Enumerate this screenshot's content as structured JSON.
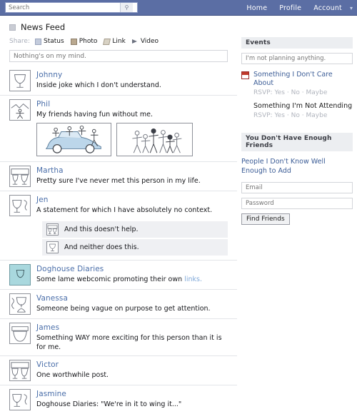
{
  "topbar": {
    "search_placeholder": "Search",
    "search_value": "",
    "search_icon": "search-icon",
    "nav": [
      {
        "label": "Home"
      },
      {
        "label": "Profile"
      },
      {
        "label": "Account"
      }
    ],
    "caret": "▾"
  },
  "page": {
    "title": "News Feed"
  },
  "share": {
    "label": "Share:",
    "items": [
      {
        "label": "Status",
        "icon": "status-icon"
      },
      {
        "label": "Photo",
        "icon": "photo-icon"
      },
      {
        "label": "Link",
        "icon": "link-icon"
      },
      {
        "label": "Video",
        "icon": "video-icon"
      }
    ],
    "status_placeholder": "Nothing's on my mind.",
    "status_value": ""
  },
  "feed": [
    {
      "name": "Johnny",
      "text": "Inside joke which I don't understand.",
      "avatar": "goblet"
    },
    {
      "name": "Phil",
      "text": "My friends having fun without me.",
      "avatar": "landscape",
      "photos": [
        {
          "caption": "car-party-photo"
        },
        {
          "caption": "crowd-photo"
        }
      ]
    },
    {
      "name": "Martha",
      "text": "Pretty sure I've never met this person in my life.",
      "avatar": "two-figures"
    },
    {
      "name": "Jen",
      "text": "A statement for which I have absolutely no context.",
      "avatar": "goblet-curve",
      "comments": [
        {
          "text": "And this doesn't help.",
          "avatar": "two-figures"
        },
        {
          "text": "And neither does this.",
          "avatar": "goblet"
        }
      ]
    },
    {
      "name": "Doghouse Diaries",
      "text_before": "Some lame webcomic promoting their own ",
      "link_text": "links.",
      "avatar": "goblet",
      "tinted": true
    },
    {
      "name": "Vanessa",
      "text": "Someone being vague on purpose to get attention.",
      "avatar": "hourglass"
    },
    {
      "name": "James",
      "text": "Something WAY more exciting for this person than it is for me.",
      "avatar": "bowl"
    },
    {
      "name": "Victor",
      "text": "One worthwhile post.",
      "avatar": "two-figures"
    },
    {
      "name": "Jasmine",
      "text": "Doghouse Diaries: \"We're in it to wing it...\"",
      "avatar": "goblet-curve"
    }
  ],
  "sidebar": {
    "events": {
      "header": "Events",
      "input_placeholder": "I'm not planning anything.",
      "input_value": "",
      "items": [
        {
          "title": "Something I Don't Care About",
          "is_link": true,
          "rsvp_label": "RSVP:",
          "yes": "Yes",
          "no": "No",
          "maybe": "Maybe",
          "sep": "·"
        },
        {
          "title": "Something I'm Not Attending",
          "is_link": false,
          "rsvp_label": "RSVP:",
          "yes": "Yes",
          "no": "No",
          "maybe": "Maybe",
          "sep": "·"
        }
      ]
    },
    "friends": {
      "header": "You Don't Have Enough Friends",
      "link": "People I Don't Know Well Enough to Add",
      "email_placeholder": "Email",
      "email_value": "",
      "password_placeholder": "Password",
      "password_value": "",
      "button": "Find Friends"
    }
  },
  "colors": {
    "header_blue": "#5b6ea4",
    "link_blue": "#4a6ea9",
    "avatar_tint": "#a9d8de",
    "comment_bg": "#eff0f3",
    "event_red": "#c0392b"
  }
}
